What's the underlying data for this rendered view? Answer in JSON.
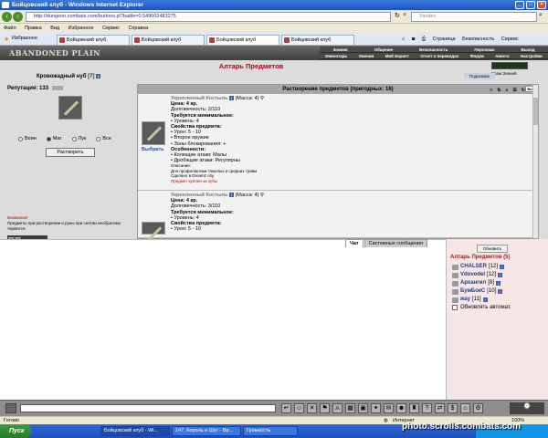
{
  "window": {
    "title": "Бойцовский клуб - Windows Internet Explorer"
  },
  "address": {
    "url": "http://dungeon.combats.com/buttons.pl?battle=0.549002483275",
    "search_placeholder": "Yandex"
  },
  "menu": [
    "Файл",
    "Правка",
    "Вид",
    "Избранное",
    "Сервис",
    "Справка"
  ],
  "tabs": {
    "favorites": "Избранное",
    "items": [
      "Бойцовский клуб.",
      "Бойцовский клуб",
      "Бойцовский клуб",
      "Бойцовский клуб"
    ]
  },
  "toolbar": {
    "page": "Страница",
    "security": "Безопасность",
    "service": "Сервис"
  },
  "game": {
    "logo": "ABANDONED PLAIN",
    "nav_row1": [
      "Знания",
      "Общение",
      "Безопасность",
      "Персонаж",
      "Выход"
    ],
    "nav_row2": [
      "Инвентарь",
      "Умения",
      "Мой Екрипт",
      "Отчет о переводах",
      "Форум",
      "Анкета",
      "Настройки"
    ],
    "title": "Алтарь Предметов",
    "hint": "Подсказка",
    "store_label": "Храм Знаний"
  },
  "player": {
    "nick": "Кровожадный нуб",
    "level": "[7]",
    "reputation_label": "Репутация:",
    "reputation_value": "133"
  },
  "filters": {
    "options": [
      "Воин",
      "Маг",
      "Лук",
      "Все"
    ],
    "selected": "Маг"
  },
  "dissolve_button": "Растворить",
  "warning": {
    "title": "Внимание!",
    "text": "Предметы при растворении и руны при снятии необратимо теряются."
  },
  "list": {
    "header": "Растворение предметов (пригодных: 16)",
    "select_value": "Все",
    "choose_label": "Выбрать",
    "items": [
      {
        "name": "Укрепленный Костыль",
        "mass": "(Масса: 4)",
        "price": "Цена: 4 кр.",
        "durability": "Долговечность: 2/110",
        "req_title": "Требуется минимальное:",
        "req_level": "• Уровень: 4",
        "props_title": "Свойства предмета:",
        "props": [
          "• Урон: 5 - 10",
          "• Второе оружие",
          "• Зоны блокирования: +"
        ],
        "feat_title": "Особенности:",
        "feats": [
          "• Колющие атаки: Малы",
          "• Дробящие атаки: Регулярны"
        ],
        "desc_title": "Описание:",
        "desc": "Для профилактики тяжелых и средних травм",
        "made": "Сделано в Dreamz city",
        "gift": "Предмет куплен за зубы"
      },
      {
        "name": "Укрепленный Костыль",
        "mass": "(Масса: 4)",
        "price": "Цена: 4 кр.",
        "durability": "Долговечность: 3/110",
        "req_title": "Требуется минимальное:",
        "req_level": "• Уровень: 4",
        "props_title": "Свойства предмета:",
        "props": [
          "• Урон: 5 - 10"
        ]
      }
    ]
  },
  "chat": {
    "tab_chat": "Чат",
    "tab_system": "Системные сообщения"
  },
  "sidebar": {
    "refresh": "Обновить",
    "title": "Алтарь Предметов (5)",
    "players": [
      {
        "name": "CHALSER",
        "level": "[12]"
      },
      {
        "name": "Vdovodel",
        "level": "[12]"
      },
      {
        "name": "Архангил",
        "level": "[8]"
      },
      {
        "name": "БумБокС",
        "level": "[10]"
      },
      {
        "name": "жау",
        "level": "[11]"
      }
    ],
    "auto_refresh": "Обновлять автомат."
  },
  "status": {
    "left": "Готово",
    "zone": "Интернет",
    "zoom": "100%"
  },
  "taskbar": {
    "start": "Пуск",
    "items": [
      "Бойцовский клуб - Wi...",
      "147. Король и Шут - Вр...",
      "Громкость"
    ]
  },
  "watermark": "photo.scrolls.combats.com"
}
